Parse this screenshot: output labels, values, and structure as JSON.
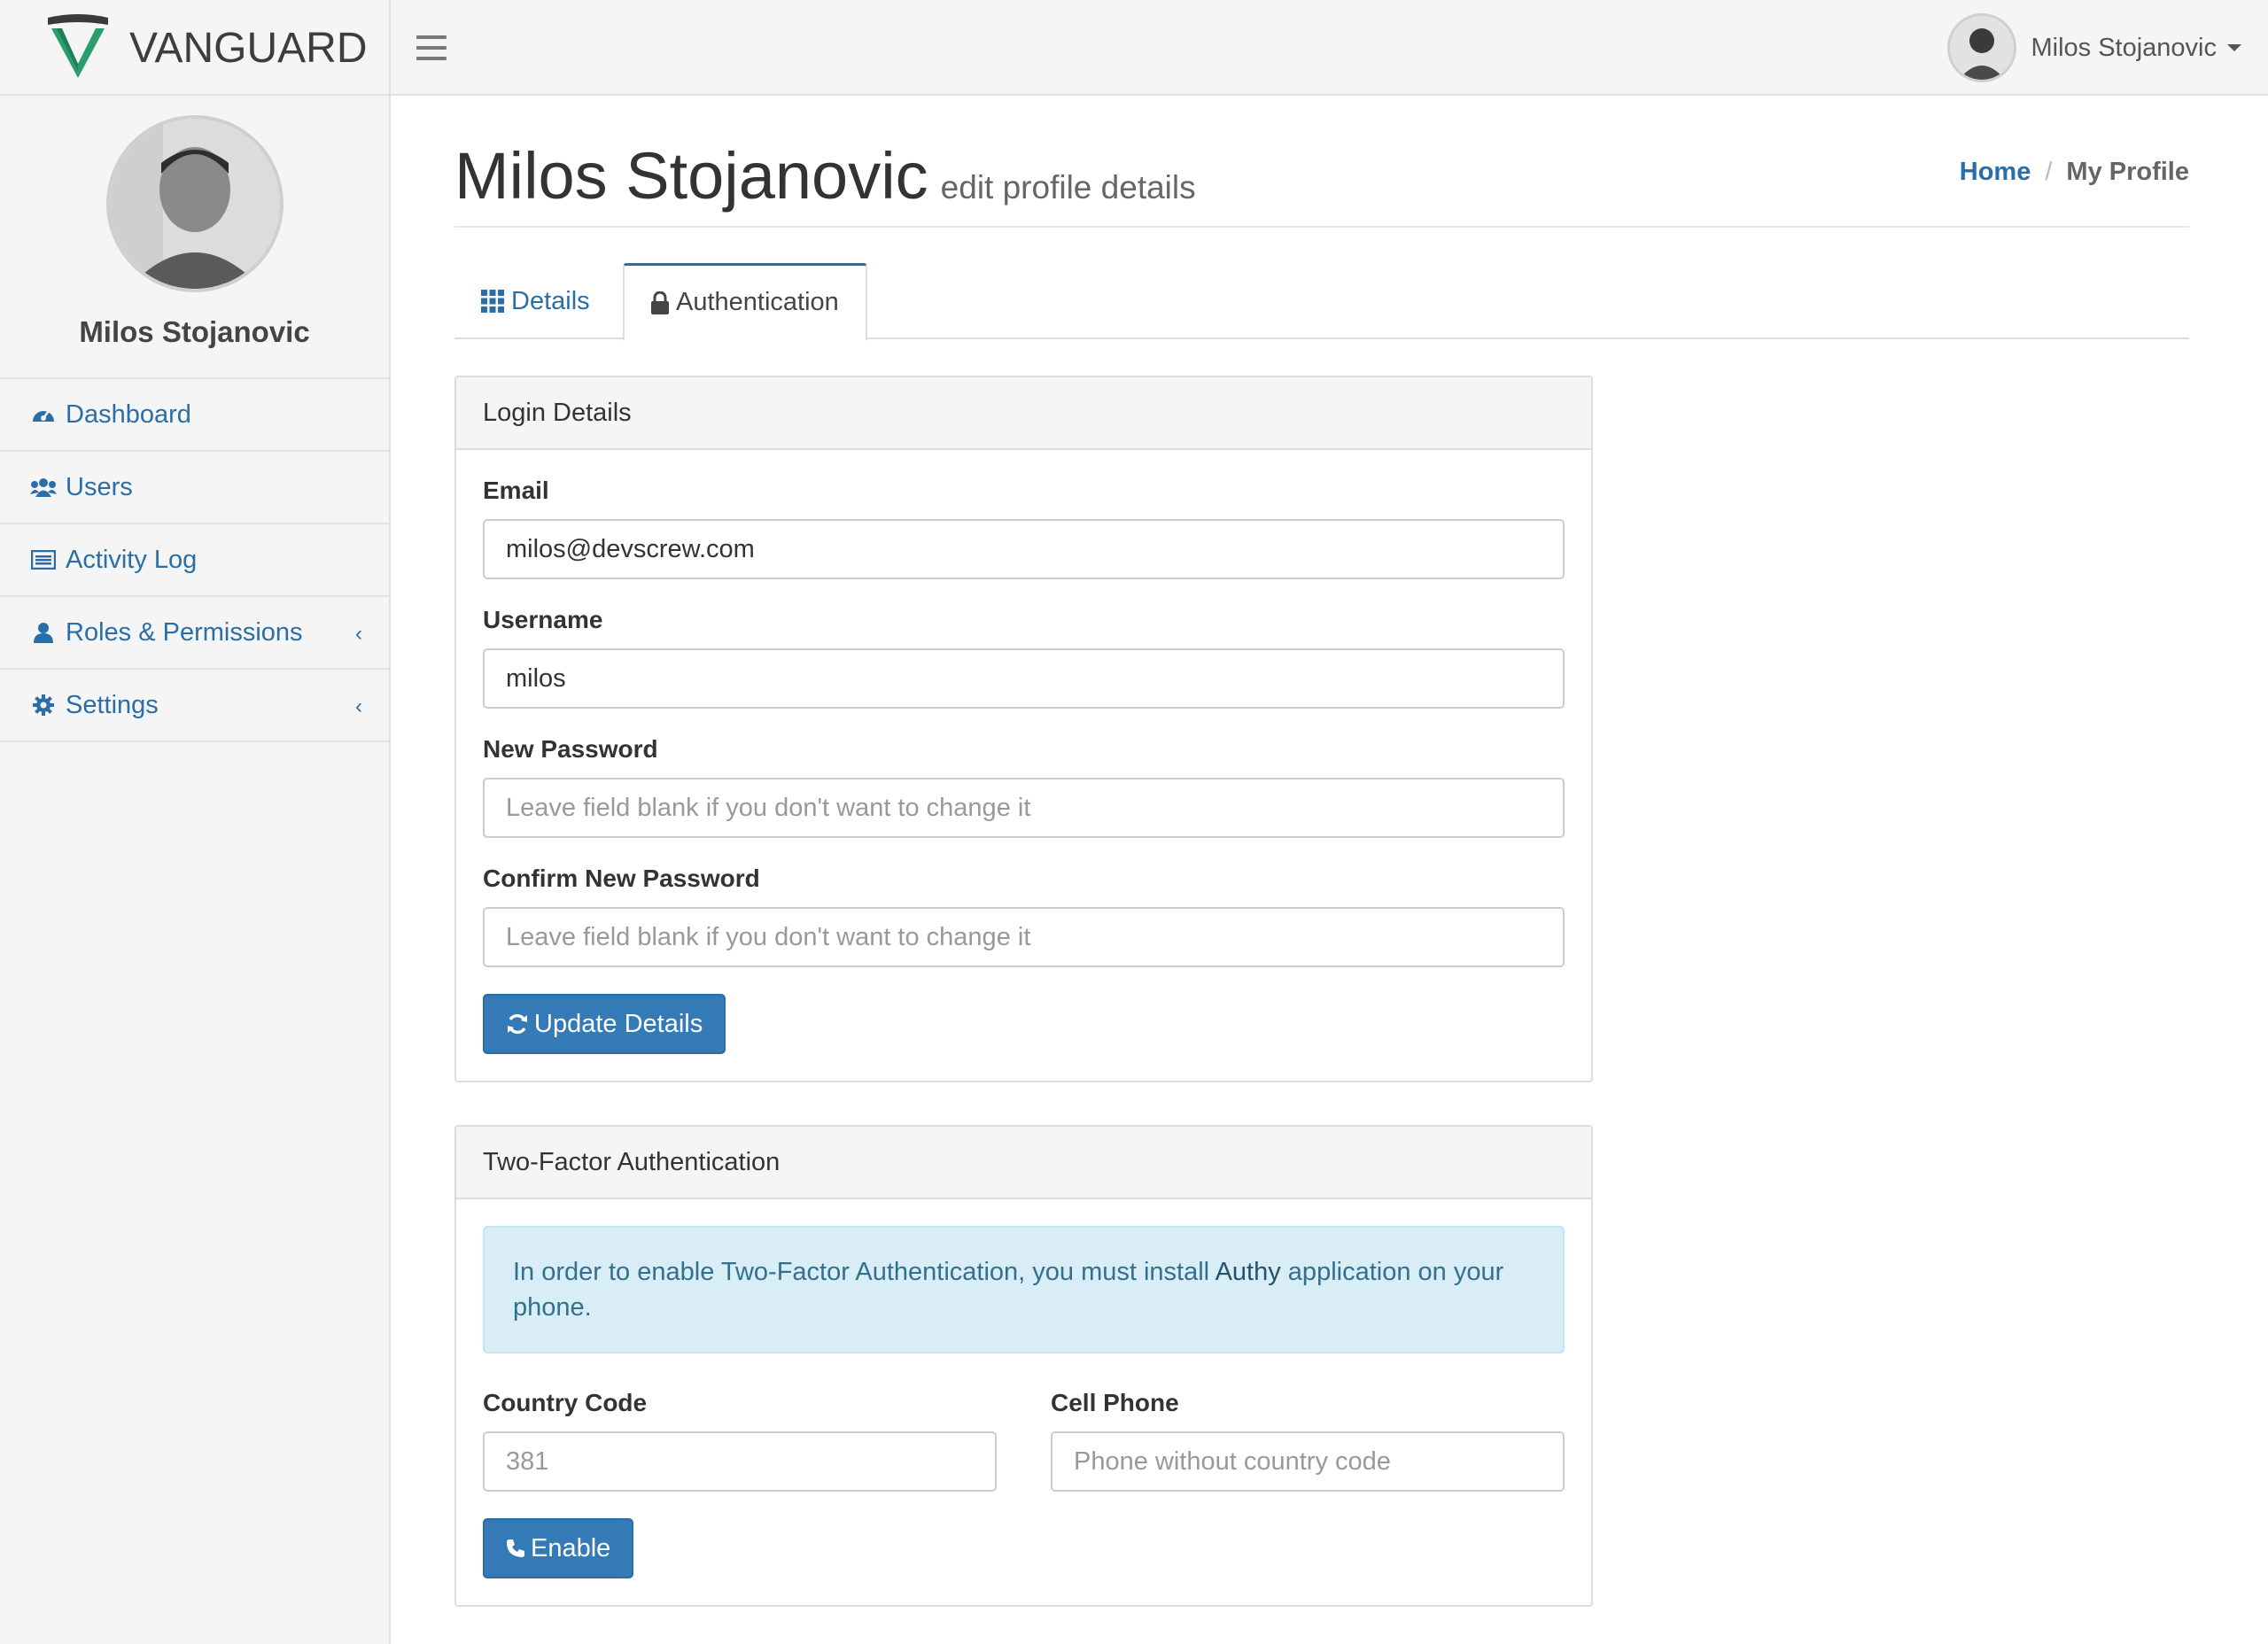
{
  "brand": {
    "name": "VANGUARD",
    "shield_color": "#2a9d6f"
  },
  "navbar": {
    "user_name": "Milos Stojanovic",
    "icons": {
      "menu": "hamburger-icon",
      "dropdown": "caret-down-icon"
    }
  },
  "sidebar": {
    "profile_name": "Milos Stojanovic",
    "items": [
      {
        "label": "Dashboard",
        "icon": "dashboard-icon"
      },
      {
        "label": "Users",
        "icon": "users-icon"
      },
      {
        "label": "Activity Log",
        "icon": "list-icon"
      },
      {
        "label": "Roles & Permissions",
        "icon": "user-icon",
        "chevron": "‹"
      },
      {
        "label": "Settings",
        "icon": "gear-icon",
        "chevron": "‹"
      }
    ]
  },
  "header": {
    "title": "Milos Stojanovic",
    "subtitle": "edit profile details",
    "breadcrumb": {
      "home": "Home",
      "separator": "/",
      "current": "My Profile"
    }
  },
  "tabs": [
    {
      "label": "Details",
      "icon": "grid-icon",
      "active": false
    },
    {
      "label": "Authentication",
      "icon": "lock-icon",
      "active": true
    }
  ],
  "login_panel": {
    "heading": "Login Details",
    "email_label": "Email",
    "email_value": "milos@devscrew.com",
    "username_label": "Username",
    "username_value": "milos",
    "new_password_label": "New Password",
    "new_password_placeholder": "Leave field blank if you don't want to change it",
    "confirm_password_label": "Confirm New Password",
    "confirm_password_placeholder": "Leave field blank if you don't want to change it",
    "update_button": "Update Details"
  },
  "twofa_panel": {
    "heading": "Two-Factor Authentication",
    "alert_prefix": "In order to enable Two-Factor Authentication, you must install ",
    "alert_link": "Authy",
    "alert_suffix": " application on your phone.",
    "country_code_label": "Country Code",
    "country_code_placeholder": "381",
    "cell_phone_label": "Cell Phone",
    "cell_phone_placeholder": "Phone without country code",
    "enable_button": "Enable"
  },
  "colors": {
    "link": "#2a6ea8",
    "primary_button": "#337ab7",
    "alert_bg": "#d9edf7",
    "alert_text": "#31708f"
  }
}
